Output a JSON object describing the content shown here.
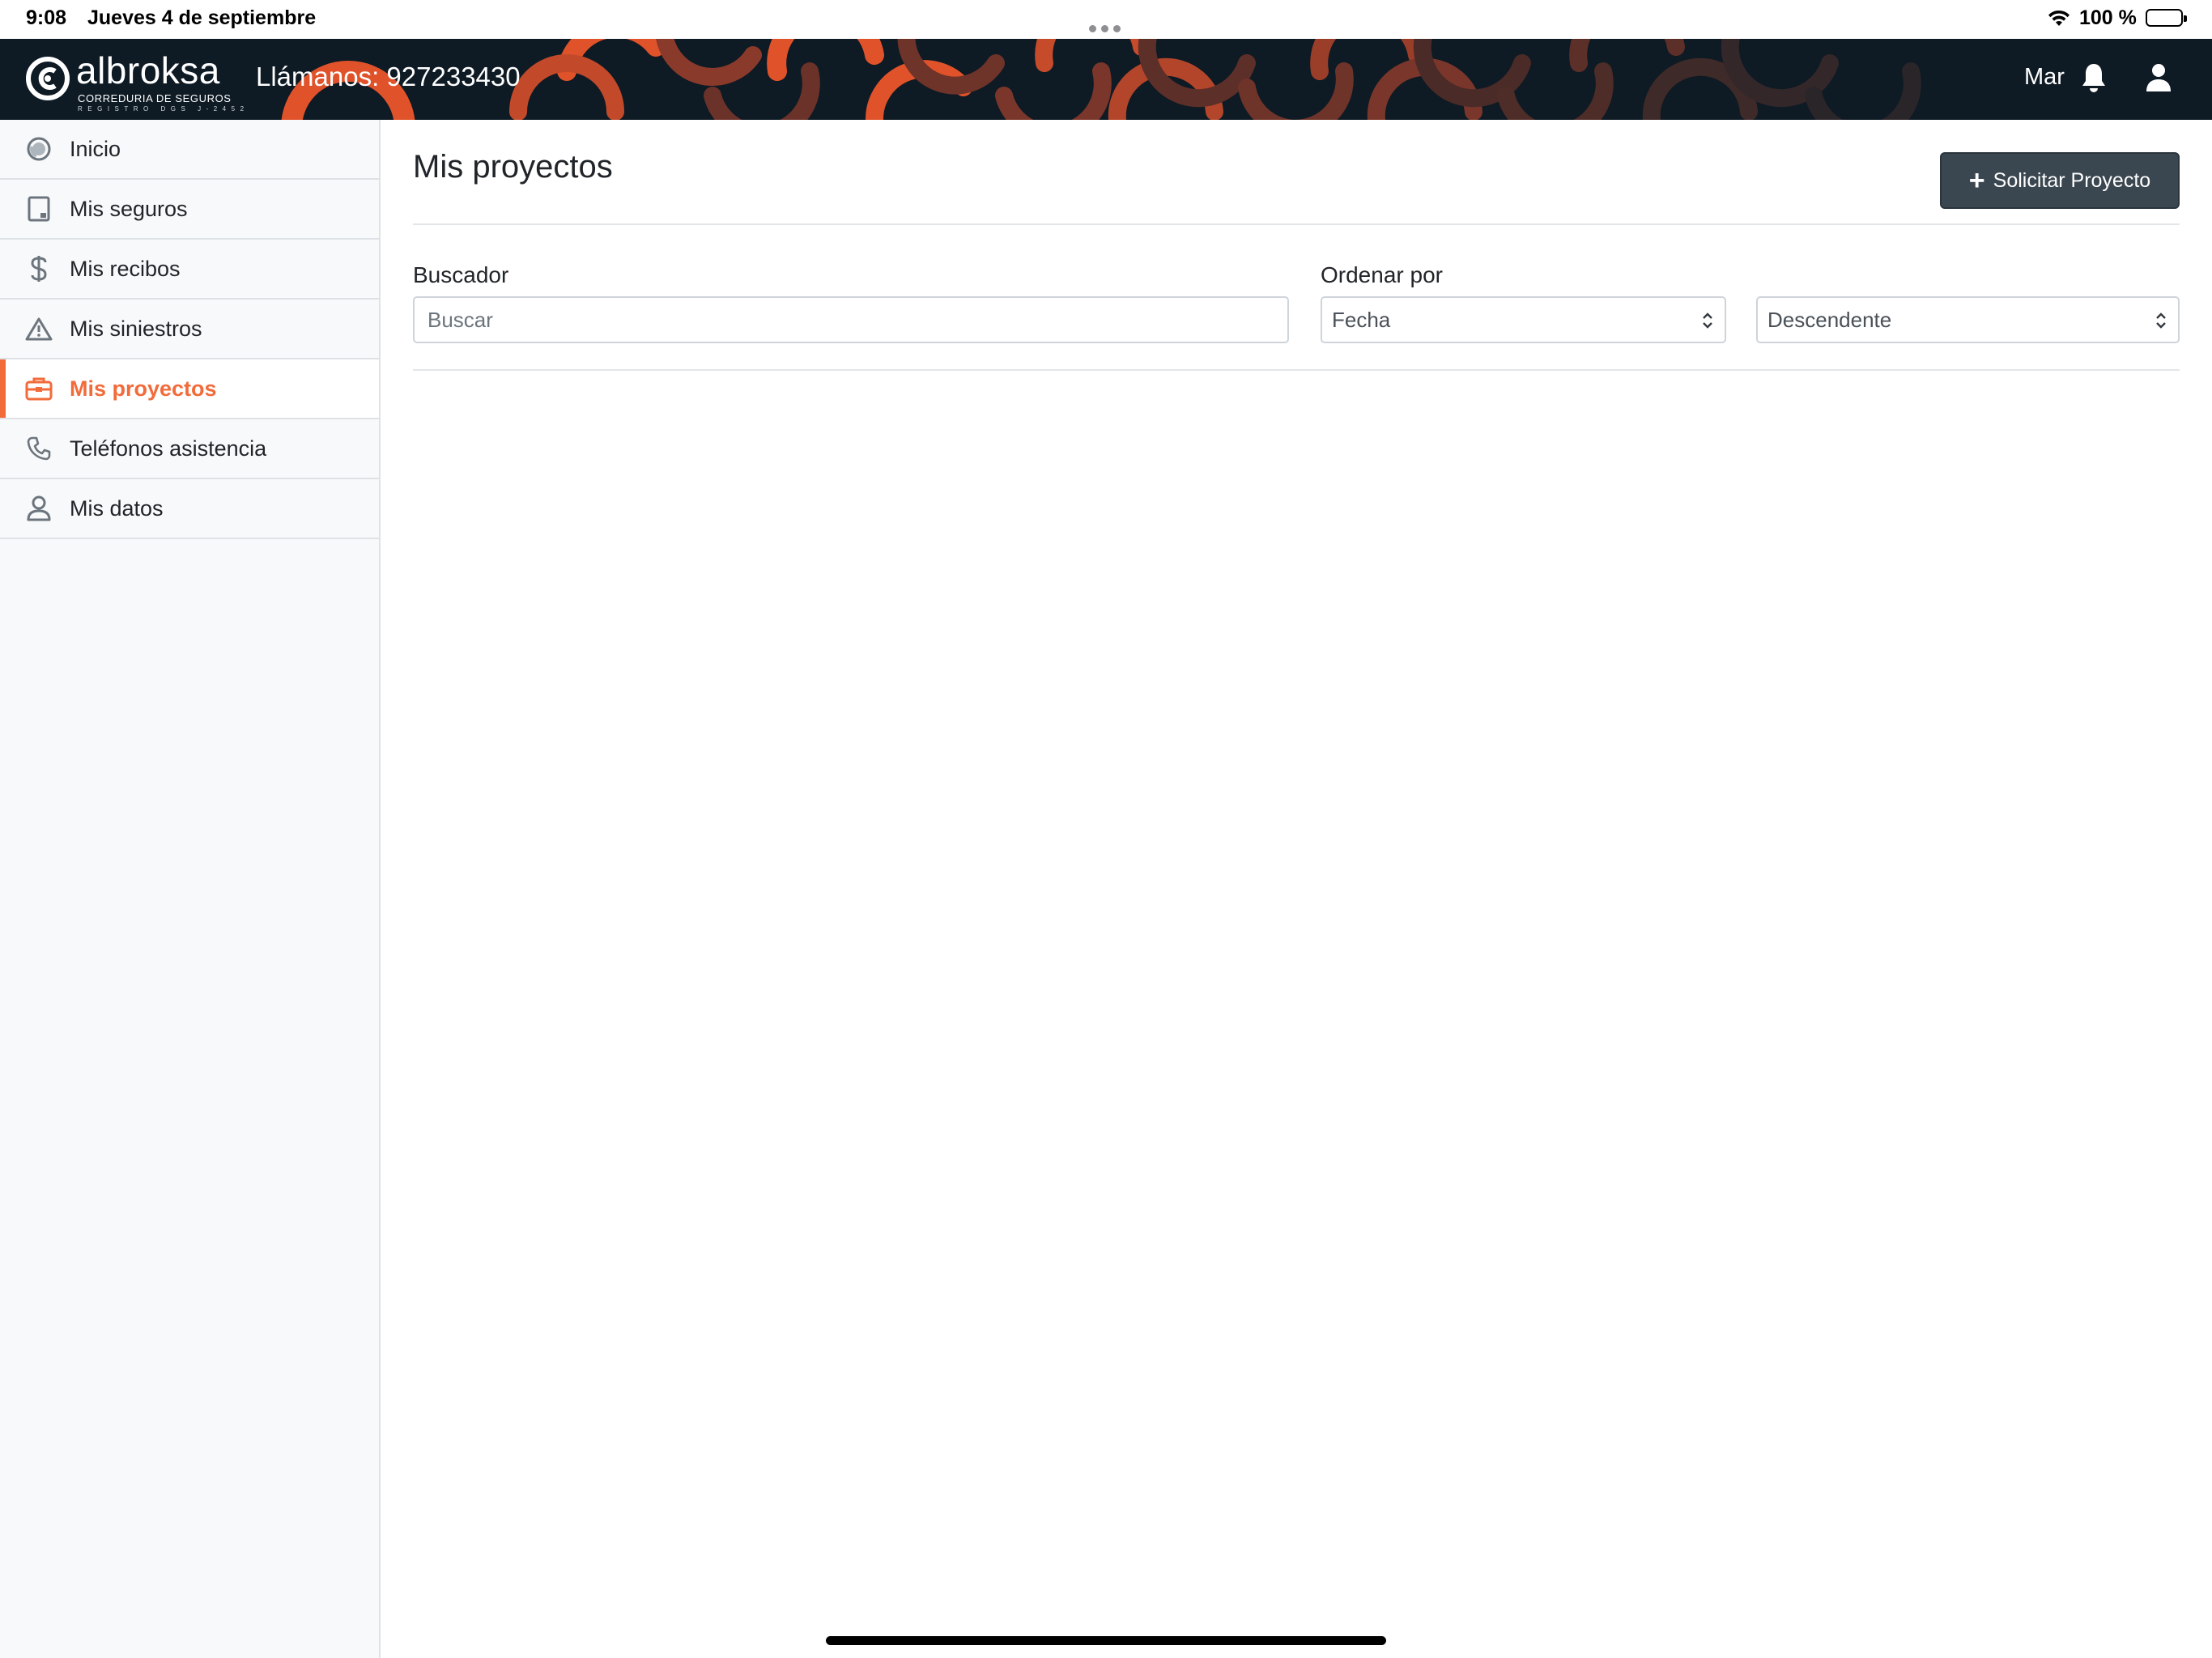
{
  "status_bar": {
    "time": "9:08",
    "date": "Jueves 4 de septiembre",
    "battery": "100 %",
    "icons": [
      "wifi-icon",
      "battery-icon"
    ]
  },
  "header": {
    "logo_text": "albroksa",
    "logo_subtitle": "CORREDURIA DE SEGUROS",
    "logo_registry": "REGISTRO DGS J-2452",
    "call_text": "Llámanos: 927233430",
    "user_name": "Mar",
    "icons": [
      "bell-icon",
      "user-icon"
    ],
    "colors": {
      "background": "#0e1a24",
      "accent": "#f26b3a"
    }
  },
  "sidebar": {
    "items": [
      {
        "label": "Inicio",
        "icon": "dashboard-icon",
        "active": false
      },
      {
        "label": "Mis seguros",
        "icon": "tablet-icon",
        "active": false
      },
      {
        "label": "Mis recibos",
        "icon": "dollar-icon",
        "active": false
      },
      {
        "label": "Mis siniestros",
        "icon": "warning-icon",
        "active": false
      },
      {
        "label": "Mis proyectos",
        "icon": "briefcase-icon",
        "active": true
      },
      {
        "label": "Teléfonos asistencia",
        "icon": "phone-icon",
        "active": false
      },
      {
        "label": "Mis datos",
        "icon": "user-icon",
        "active": false
      }
    ]
  },
  "main": {
    "title": "Mis proyectos",
    "request_button": "Solicitar Proyecto",
    "search": {
      "label": "Buscador",
      "placeholder": "Buscar",
      "value": ""
    },
    "order": {
      "label": "Ordenar por",
      "field_value": "Fecha",
      "direction_value": "Descendente"
    }
  }
}
